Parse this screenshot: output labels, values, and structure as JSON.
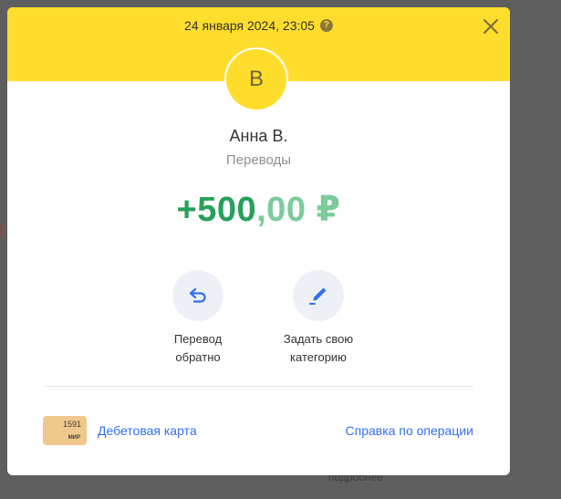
{
  "background": {
    "partial_text": "подробнее"
  },
  "header": {
    "datetime": "24 января 2024, 23:05",
    "help_icon": "question-circle-icon",
    "close_icon": "close-icon"
  },
  "operation": {
    "avatar_letter": "B",
    "name": "Анна В.",
    "category": "Переводы",
    "amount_integer": "+500",
    "amount_fraction": ",00 ₽"
  },
  "actions": [
    {
      "icon": "return-arrow-icon",
      "label": "Перевод\nобратно"
    },
    {
      "icon": "pencil-icon",
      "label": "Задать свою\nкатегорию"
    }
  ],
  "footer": {
    "card_number": "1591",
    "card_system": "МИР",
    "card_label": "Дебетовая карта",
    "help_link": "Справка по операции"
  },
  "colors": {
    "header_yellow": "#ffdd2d",
    "amount_green": "#27a05a",
    "amount_fraction_green": "#7ccb9b",
    "link_blue": "#336fee",
    "action_bg": "#edf1f5"
  }
}
